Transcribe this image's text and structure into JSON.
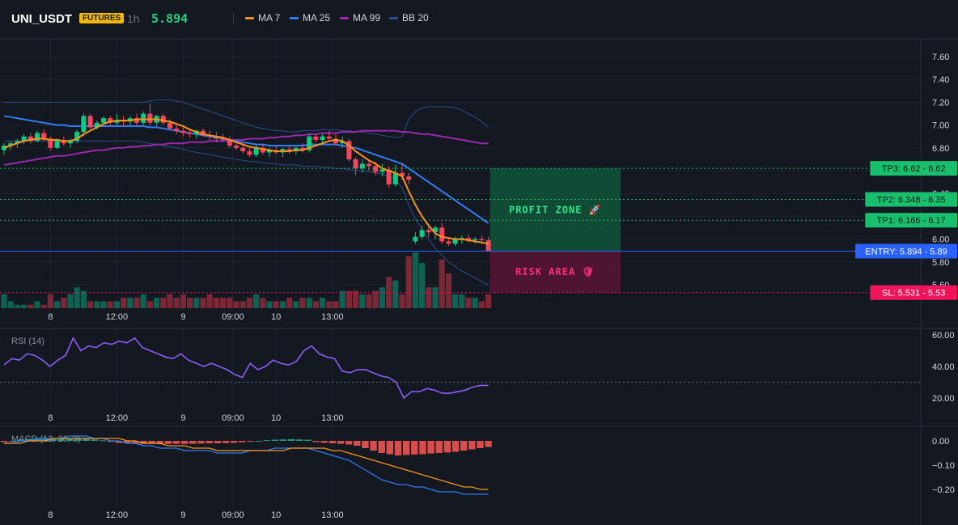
{
  "header": {
    "symbol": "UNI_USDT",
    "badge": "FUTURES",
    "timeframe": "1h",
    "last_price": "5.894",
    "legend": [
      {
        "name": "MA 7",
        "color": "#f7931a"
      },
      {
        "name": "MA 25",
        "color": "#2f7cf6"
      },
      {
        "name": "MA 99",
        "color": "#9c27b0"
      },
      {
        "name": "BB 20",
        "color": "#2a4d8f"
      }
    ]
  },
  "price_axis": [
    "7.60",
    "7.40",
    "7.20",
    "7.00",
    "6.80",
    "6.60",
    "6.40",
    "6.20",
    "6.00",
    "5.80",
    "5.60"
  ],
  "time_axis": [
    {
      "label": "8",
      "t": 7
    },
    {
      "label": "12:00",
      "t": 17
    },
    {
      "label": "9",
      "t": 27
    },
    {
      "label": "09:00",
      "t": 34.5
    },
    {
      "label": "10",
      "t": 41
    },
    {
      "label": "13:00",
      "t": 49.5
    }
  ],
  "levels": {
    "tp3": {
      "label": "TP3: 6.62 - 6.62",
      "price": 6.62,
      "color": "#18c06e"
    },
    "tp2": {
      "label": "TP2: 6.348 - 6.35",
      "price": 6.348,
      "color": "#18c06e"
    },
    "tp1": {
      "label": "TP1: 6.166 - 6.17",
      "price": 6.166,
      "color": "#18c06e"
    },
    "entry": {
      "label": "ENTRY: 5.894 - 5.89",
      "price": 5.894,
      "color": "#2962ff"
    },
    "sl": {
      "label": "SL: 5.531 - 5.53",
      "price": 5.531,
      "color": "#f0145a"
    }
  },
  "zones": {
    "profit_label": "PROFIT ZONE 🚀",
    "risk_label": "RISK AREA 🛡"
  },
  "rsi": {
    "label": "RSI (14)",
    "axis": [
      "60.00",
      "40.00",
      "20.00"
    ],
    "level": 30,
    "color": "#8b5cf6"
  },
  "macd": {
    "label": "MACD (12, 26, 9)",
    "axis": [
      "0.00",
      "−0.10",
      "−0.20"
    ],
    "macd_color": "#2f7cf6",
    "signal_color": "#f7931a"
  },
  "chart_data": {
    "type": "candlestick",
    "x_unit": "hourly candles",
    "candles": [
      {
        "o": 6.78,
        "h": 6.84,
        "l": 6.74,
        "c": 6.82
      },
      {
        "o": 6.82,
        "h": 6.86,
        "l": 6.78,
        "c": 6.84
      },
      {
        "o": 6.84,
        "h": 6.88,
        "l": 6.8,
        "c": 6.86
      },
      {
        "o": 6.86,
        "h": 6.92,
        "l": 6.83,
        "c": 6.9
      },
      {
        "o": 6.9,
        "h": 6.93,
        "l": 6.84,
        "c": 6.86
      },
      {
        "o": 6.86,
        "h": 6.95,
        "l": 6.85,
        "c": 6.93
      },
      {
        "o": 6.93,
        "h": 6.96,
        "l": 6.86,
        "c": 6.88
      },
      {
        "o": 6.88,
        "h": 6.9,
        "l": 6.78,
        "c": 6.8
      },
      {
        "o": 6.8,
        "h": 6.88,
        "l": 6.79,
        "c": 6.86
      },
      {
        "o": 6.86,
        "h": 6.9,
        "l": 6.82,
        "c": 6.84
      },
      {
        "o": 6.84,
        "h": 6.88,
        "l": 6.8,
        "c": 6.86
      },
      {
        "o": 6.86,
        "h": 6.96,
        "l": 6.84,
        "c": 6.94
      },
      {
        "o": 6.94,
        "h": 7.1,
        "l": 6.9,
        "c": 7.08
      },
      {
        "o": 7.08,
        "h": 7.1,
        "l": 6.96,
        "c": 6.98
      },
      {
        "o": 6.98,
        "h": 7.04,
        "l": 6.96,
        "c": 7.02
      },
      {
        "o": 7.02,
        "h": 7.08,
        "l": 7.0,
        "c": 7.06
      },
      {
        "o": 7.06,
        "h": 7.08,
        "l": 7.0,
        "c": 7.02
      },
      {
        "o": 7.02,
        "h": 7.1,
        "l": 7.0,
        "c": 7.04
      },
      {
        "o": 7.04,
        "h": 7.08,
        "l": 6.99,
        "c": 7.03
      },
      {
        "o": 7.03,
        "h": 7.08,
        "l": 7.0,
        "c": 7.06
      },
      {
        "o": 7.06,
        "h": 7.1,
        "l": 7.0,
        "c": 7.02
      },
      {
        "o": 7.02,
        "h": 7.12,
        "l": 7.0,
        "c": 7.1
      },
      {
        "o": 7.1,
        "h": 7.19,
        "l": 7.0,
        "c": 7.02
      },
      {
        "o": 7.02,
        "h": 7.09,
        "l": 6.99,
        "c": 7.08
      },
      {
        "o": 7.08,
        "h": 7.1,
        "l": 7.0,
        "c": 7.02
      },
      {
        "o": 7.02,
        "h": 7.05,
        "l": 6.95,
        "c": 6.97
      },
      {
        "o": 6.97,
        "h": 7.0,
        "l": 6.92,
        "c": 6.95
      },
      {
        "o": 6.95,
        "h": 6.98,
        "l": 6.9,
        "c": 6.93
      },
      {
        "o": 6.93,
        "h": 6.97,
        "l": 6.89,
        "c": 6.92
      },
      {
        "o": 6.92,
        "h": 6.96,
        "l": 6.88,
        "c": 6.95
      },
      {
        "o": 6.95,
        "h": 6.97,
        "l": 6.9,
        "c": 6.91
      },
      {
        "o": 6.91,
        "h": 6.95,
        "l": 6.87,
        "c": 6.9
      },
      {
        "o": 6.9,
        "h": 6.94,
        "l": 6.85,
        "c": 6.88
      },
      {
        "o": 6.88,
        "h": 6.92,
        "l": 6.85,
        "c": 6.87
      },
      {
        "o": 6.87,
        "h": 6.9,
        "l": 6.8,
        "c": 6.82
      },
      {
        "o": 6.82,
        "h": 6.86,
        "l": 6.78,
        "c": 6.8
      },
      {
        "o": 6.8,
        "h": 6.84,
        "l": 6.75,
        "c": 6.77
      },
      {
        "o": 6.77,
        "h": 6.8,
        "l": 6.72,
        "c": 6.74
      },
      {
        "o": 6.74,
        "h": 6.82,
        "l": 6.72,
        "c": 6.8
      },
      {
        "o": 6.8,
        "h": 6.83,
        "l": 6.74,
        "c": 6.76
      },
      {
        "o": 6.76,
        "h": 6.8,
        "l": 6.72,
        "c": 6.78
      },
      {
        "o": 6.78,
        "h": 6.82,
        "l": 6.74,
        "c": 6.76
      },
      {
        "o": 6.76,
        "h": 6.8,
        "l": 6.72,
        "c": 6.79
      },
      {
        "o": 6.79,
        "h": 6.82,
        "l": 6.75,
        "c": 6.77
      },
      {
        "o": 6.77,
        "h": 6.81,
        "l": 6.74,
        "c": 6.8
      },
      {
        "o": 6.8,
        "h": 6.84,
        "l": 6.76,
        "c": 6.78
      },
      {
        "o": 6.78,
        "h": 6.92,
        "l": 6.76,
        "c": 6.9
      },
      {
        "o": 6.9,
        "h": 6.92,
        "l": 6.85,
        "c": 6.87
      },
      {
        "o": 6.87,
        "h": 6.92,
        "l": 6.84,
        "c": 6.9
      },
      {
        "o": 6.9,
        "h": 6.95,
        "l": 6.86,
        "c": 6.88
      },
      {
        "o": 6.88,
        "h": 6.92,
        "l": 6.82,
        "c": 6.84
      },
      {
        "o": 6.84,
        "h": 6.9,
        "l": 6.8,
        "c": 6.86
      },
      {
        "o": 6.86,
        "h": 6.88,
        "l": 6.68,
        "c": 6.7
      },
      {
        "o": 6.7,
        "h": 6.72,
        "l": 6.56,
        "c": 6.62
      },
      {
        "o": 6.62,
        "h": 6.7,
        "l": 6.58,
        "c": 6.66
      },
      {
        "o": 6.66,
        "h": 6.7,
        "l": 6.6,
        "c": 6.64
      },
      {
        "o": 6.64,
        "h": 6.68,
        "l": 6.56,
        "c": 6.59
      },
      {
        "o": 6.59,
        "h": 6.66,
        "l": 6.55,
        "c": 6.61
      },
      {
        "o": 6.61,
        "h": 6.64,
        "l": 6.45,
        "c": 6.48
      },
      {
        "o": 6.48,
        "h": 6.65,
        "l": 6.46,
        "c": 6.58
      },
      {
        "o": 6.58,
        "h": 6.66,
        "l": 6.52,
        "c": 6.55
      },
      {
        "o": 6.55,
        "h": 6.58,
        "l": 6.48,
        "c": 6.52
      },
      {
        "o": 5.98,
        "h": 6.06,
        "l": 5.96,
        "c": 6.02
      },
      {
        "o": 6.02,
        "h": 6.12,
        "l": 6.0,
        "c": 6.08
      },
      {
        "o": 6.08,
        "h": 6.12,
        "l": 6.02,
        "c": 6.06
      },
      {
        "o": 6.06,
        "h": 6.12,
        "l": 6.0,
        "c": 6.1
      },
      {
        "o": 6.1,
        "h": 6.14,
        "l": 5.96,
        "c": 5.98
      },
      {
        "o": 5.98,
        "h": 6.02,
        "l": 5.94,
        "c": 5.96
      },
      {
        "o": 5.96,
        "h": 6.02,
        "l": 5.94,
        "c": 6.0
      },
      {
        "o": 6.0,
        "h": 6.03,
        "l": 5.96,
        "c": 6.01
      },
      {
        "o": 6.01,
        "h": 6.04,
        "l": 5.97,
        "c": 5.99
      },
      {
        "o": 5.99,
        "h": 6.02,
        "l": 5.96,
        "c": 6.0
      },
      {
        "o": 6.0,
        "h": 6.03,
        "l": 5.97,
        "c": 5.99
      },
      {
        "o": 5.99,
        "h": 6.02,
        "l": 5.9,
        "c": 5.894
      }
    ],
    "volume": [
      4,
      2,
      1,
      1,
      1,
      2,
      1,
      4,
      2,
      3,
      4,
      6,
      5,
      2,
      2,
      2,
      2,
      2,
      3,
      3,
      3,
      4,
      2,
      3,
      3,
      4,
      3,
      4,
      3,
      3,
      3,
      4,
      3,
      3,
      3,
      2,
      2,
      3,
      4,
      3,
      2,
      2,
      2,
      3,
      2,
      3,
      3,
      2,
      3,
      2,
      2,
      5,
      5,
      5,
      4,
      4,
      5,
      6,
      9,
      8,
      4,
      15,
      16,
      13,
      6,
      6,
      14,
      10,
      4,
      4,
      3,
      3,
      2,
      4
    ],
    "ma7": [
      6.8,
      6.82,
      6.84,
      6.86,
      6.87,
      6.88,
      6.88,
      6.87,
      6.87,
      6.86,
      6.86,
      6.88,
      6.92,
      6.95,
      6.98,
      7.01,
      7.03,
      7.04,
      7.04,
      7.04,
      7.05,
      7.05,
      7.05,
      7.05,
      7.04,
      7.03,
      7.01,
      6.99,
      6.96,
      6.94,
      6.92,
      6.91,
      6.9,
      6.89,
      6.87,
      6.85,
      6.83,
      6.81,
      6.8,
      6.79,
      6.78,
      6.77,
      6.77,
      6.77,
      6.78,
      6.78,
      6.8,
      6.82,
      6.84,
      6.86,
      6.87,
      6.86,
      6.82,
      6.77,
      6.73,
      6.69,
      6.66,
      6.62,
      6.6,
      6.58,
      6.55,
      6.42,
      6.3,
      6.2,
      6.12,
      6.05,
      6.02,
      6.01,
      6.0,
      6.0,
      5.99,
      5.98,
      5.97,
      5.96
    ],
    "ma25": [
      7.08,
      7.07,
      7.06,
      7.05,
      7.04,
      7.03,
      7.02,
      7.01,
      7.0,
      7.0,
      6.99,
      6.99,
      6.99,
      6.99,
      6.99,
      6.99,
      6.99,
      6.99,
      6.99,
      6.99,
      6.99,
      6.99,
      6.98,
      6.98,
      6.97,
      6.96,
      6.95,
      6.94,
      6.93,
      6.92,
      6.91,
      6.9,
      6.89,
      6.88,
      6.87,
      6.86,
      6.85,
      6.84,
      6.83,
      6.83,
      6.82,
      6.82,
      6.82,
      6.82,
      6.82,
      6.82,
      6.83,
      6.83,
      6.83,
      6.83,
      6.83,
      6.82,
      6.81,
      6.8,
      6.78,
      6.76,
      6.74,
      6.72,
      6.7,
      6.68,
      6.66,
      6.62,
      6.58,
      6.54,
      6.5,
      6.46,
      6.42,
      6.38,
      6.34,
      6.3,
      6.26,
      6.22,
      6.18,
      6.14
    ],
    "ma99": [
      6.65,
      6.66,
      6.67,
      6.68,
      6.69,
      6.7,
      6.71,
      6.72,
      6.73,
      6.73,
      6.74,
      6.75,
      6.76,
      6.77,
      6.78,
      6.78,
      6.79,
      6.8,
      6.8,
      6.81,
      6.81,
      6.82,
      6.82,
      6.83,
      6.83,
      6.84,
      6.84,
      6.84,
      6.85,
      6.85,
      6.85,
      6.86,
      6.86,
      6.86,
      6.87,
      6.87,
      6.87,
      6.88,
      6.88,
      6.88,
      6.89,
      6.89,
      6.9,
      6.9,
      6.91,
      6.91,
      6.92,
      6.92,
      6.93,
      6.93,
      6.93,
      6.94,
      6.94,
      6.94,
      6.95,
      6.95,
      6.95,
      6.95,
      6.95,
      6.95,
      6.94,
      6.94,
      6.93,
      6.92,
      6.92,
      6.91,
      6.9,
      6.89,
      6.88,
      6.87,
      6.86,
      6.85,
      6.84,
      6.84
    ],
    "bb_upper": [
      7.2,
      7.2,
      7.2,
      7.2,
      7.2,
      7.2,
      7.2,
      7.2,
      7.2,
      7.2,
      7.2,
      7.2,
      7.2,
      7.2,
      7.2,
      7.2,
      7.2,
      7.2,
      7.2,
      7.2,
      7.2,
      7.2,
      7.21,
      7.22,
      7.22,
      7.22,
      7.21,
      7.2,
      7.18,
      7.16,
      7.14,
      7.12,
      7.1,
      7.08,
      7.06,
      7.04,
      7.02,
      7.0,
      6.98,
      6.97,
      6.96,
      6.95,
      6.95,
      6.94,
      6.94,
      6.95,
      6.95,
      6.95,
      6.96,
      6.96,
      6.96,
      6.95,
      6.95,
      6.94,
      6.94,
      6.93,
      6.92,
      6.91,
      6.9,
      6.89,
      6.9,
      7.05,
      7.12,
      7.15,
      7.16,
      7.16,
      7.16,
      7.16,
      7.15,
      7.13,
      7.1,
      7.07,
      7.03,
      6.98
    ],
    "bb_lower": [
      6.86,
      6.86,
      6.86,
      6.86,
      6.86,
      6.86,
      6.86,
      6.86,
      6.86,
      6.86,
      6.86,
      6.86,
      6.86,
      6.86,
      6.86,
      6.86,
      6.86,
      6.86,
      6.86,
      6.86,
      6.86,
      6.85,
      6.84,
      6.83,
      6.82,
      6.81,
      6.8,
      6.79,
      6.77,
      6.76,
      6.75,
      6.74,
      6.73,
      6.72,
      6.71,
      6.7,
      6.69,
      6.68,
      6.68,
      6.67,
      6.66,
      6.66,
      6.65,
      6.65,
      6.65,
      6.64,
      6.64,
      6.64,
      6.63,
      6.63,
      6.62,
      6.62,
      6.61,
      6.6,
      6.6,
      6.59,
      6.58,
      6.57,
      6.55,
      6.52,
      6.45,
      6.3,
      6.18,
      6.08,
      6.0,
      5.92,
      5.86,
      5.8,
      5.76,
      5.72,
      5.69,
      5.66,
      5.63,
      5.6
    ],
    "rsi": [
      41,
      45,
      44,
      48,
      47,
      44,
      40,
      44,
      47,
      58,
      50,
      53,
      52,
      55,
      54,
      56,
      55,
      58,
      52,
      50,
      48,
      46,
      45,
      48,
      44,
      42,
      40,
      42,
      40,
      38,
      35,
      33,
      42,
      38,
      40,
      44,
      42,
      41,
      43,
      50,
      53,
      48,
      46,
      45,
      37,
      36,
      38,
      38,
      36,
      34,
      33,
      30,
      20,
      24,
      24,
      26,
      25,
      23,
      23,
      24,
      25,
      27,
      28,
      28
    ],
    "macd_line": [
      -0.01,
      -0.01,
      0.0,
      0.0,
      0.01,
      0.01,
      0.01,
      0.01,
      0.02,
      0.02,
      0.02,
      0.01,
      0.01,
      0.0,
      0.0,
      -0.01,
      -0.01,
      -0.02,
      -0.02,
      -0.03,
      -0.03,
      -0.03,
      -0.04,
      -0.04,
      -0.04,
      -0.04,
      -0.05,
      -0.05,
      -0.05,
      -0.05,
      -0.04,
      -0.04,
      -0.04,
      -0.03,
      -0.03,
      -0.03,
      -0.03,
      -0.03,
      -0.04,
      -0.05,
      -0.06,
      -0.07,
      -0.08,
      -0.1,
      -0.12,
      -0.14,
      -0.16,
      -0.17,
      -0.18,
      -0.18,
      -0.19,
      -0.19,
      -0.2,
      -0.21,
      -0.21,
      -0.21,
      -0.22,
      -0.22,
      -0.22,
      -0.22
    ],
    "macd_signal": [
      -0.01,
      -0.01,
      -0.01,
      0.0,
      0.0,
      0.0,
      0.01,
      0.01,
      0.01,
      0.01,
      0.01,
      0.01,
      0.01,
      0.01,
      0.01,
      0.0,
      0.0,
      -0.01,
      -0.01,
      -0.01,
      -0.02,
      -0.02,
      -0.02,
      -0.03,
      -0.03,
      -0.03,
      -0.04,
      -0.04,
      -0.04,
      -0.04,
      -0.04,
      -0.04,
      -0.04,
      -0.04,
      -0.04,
      -0.03,
      -0.03,
      -0.03,
      -0.03,
      -0.03,
      -0.04,
      -0.04,
      -0.05,
      -0.06,
      -0.07,
      -0.08,
      -0.09,
      -0.1,
      -0.11,
      -0.12,
      -0.13,
      -0.14,
      -0.15,
      -0.16,
      -0.17,
      -0.18,
      -0.19,
      -0.19,
      -0.2,
      -0.2
    ],
    "macd_hist": [
      -0.005,
      0.0,
      0.005,
      0.008,
      0.01,
      0.01,
      0.008,
      0.008,
      0.01,
      0.01,
      0.012,
      0.006,
      0.002,
      -0.004,
      -0.008,
      -0.01,
      -0.012,
      -0.013,
      -0.013,
      -0.014,
      -0.013,
      -0.012,
      -0.013,
      -0.012,
      -0.011,
      -0.01,
      -0.01,
      -0.009,
      -0.008,
      -0.006,
      -0.003,
      0.0,
      0.003,
      0.005,
      0.006,
      0.007,
      0.006,
      0.005,
      -0.005,
      -0.008,
      -0.01,
      -0.012,
      -0.015,
      -0.02,
      -0.03,
      -0.04,
      -0.05,
      -0.055,
      -0.06,
      -0.058,
      -0.056,
      -0.055,
      -0.052,
      -0.05,
      -0.048,
      -0.045,
      -0.04,
      -0.035,
      -0.03,
      -0.025
    ]
  }
}
